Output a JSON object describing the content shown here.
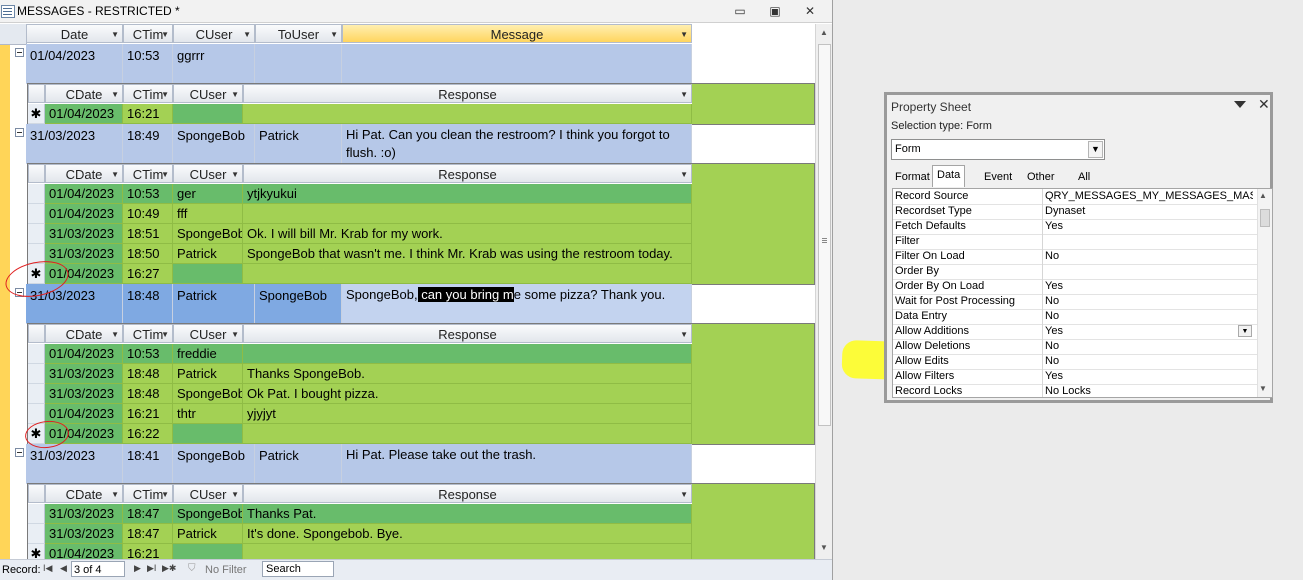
{
  "window": {
    "title": "MESSAGES - RESTRICTED *",
    "min_glyph": "▭",
    "max_glyph": "▣",
    "close_glyph": "✕"
  },
  "master_headers": [
    "Date",
    "CTim",
    "CUser",
    "ToUser",
    "Message"
  ],
  "sub_headers": [
    "CDate",
    "CTim",
    "CUser",
    "Response"
  ],
  "records": [
    {
      "date": "01/04/2023",
      "time": "10:53",
      "cuser": "ggrrr",
      "touser": "",
      "message": "",
      "responses": [
        {
          "date": "01/04/2023",
          "time": "16:21",
          "user": "",
          "text": "",
          "new": true
        }
      ]
    },
    {
      "date": "31/03/2023",
      "time": "18:49",
      "cuser": "SpongeBob",
      "touser": "Patrick",
      "message": "Hi Pat. Can you clean the restroom? I think you forgot to flush. :o)",
      "responses": [
        {
          "date": "01/04/2023",
          "time": "10:53",
          "user": "ger",
          "text": "ytjkyukui"
        },
        {
          "date": "01/04/2023",
          "time": "10:49",
          "user": "fff",
          "text": ""
        },
        {
          "date": "31/03/2023",
          "time": "18:51",
          "user": "SpongeBob",
          "text": "Ok. I will bill Mr. Krab for my work."
        },
        {
          "date": "31/03/2023",
          "time": "18:50",
          "user": "Patrick",
          "text": "SpongeBob that wasn't me. I think Mr. Krab was using the restroom today."
        },
        {
          "date": "01/04/2023",
          "time": "16:27",
          "user": "",
          "text": "",
          "new": true
        }
      ]
    },
    {
      "date": "31/03/2023",
      "time": "18:48",
      "cuser": "Patrick",
      "touser": "SpongeBob",
      "message_pre": "SpongeBob,",
      "message_sel": " can you bring m",
      "message_post": "e some pizza? Thank you.",
      "current": true,
      "responses": [
        {
          "date": "01/04/2023",
          "time": "10:53",
          "user": "freddie",
          "text": ""
        },
        {
          "date": "31/03/2023",
          "time": "18:48",
          "user": "Patrick",
          "text": "Thanks SpongeBob."
        },
        {
          "date": "31/03/2023",
          "time": "18:48",
          "user": "SpongeBob",
          "text": "Ok Pat. I bought pizza."
        },
        {
          "date": "01/04/2023",
          "time": "16:21",
          "user": "thtr",
          "text": "yjyjyt"
        },
        {
          "date": "01/04/2023",
          "time": "16:22",
          "user": "",
          "text": "",
          "new": true
        }
      ]
    },
    {
      "date": "31/03/2023",
      "time": "18:41",
      "cuser": "SpongeBob",
      "touser": "Patrick",
      "message": "Hi Pat. Please take out the trash.",
      "responses": [
        {
          "date": "31/03/2023",
          "time": "18:47",
          "user": "SpongeBob",
          "text": "Thanks Pat."
        },
        {
          "date": "31/03/2023",
          "time": "18:47",
          "user": "Patrick",
          "text": "It's done. Spongebob. Bye."
        },
        {
          "date": "01/04/2023",
          "time": "16:21",
          "user": "",
          "text": "",
          "new": true
        }
      ]
    }
  ],
  "navigation": {
    "label": "Record:",
    "current": "3 of 4",
    "filter": "No Filter",
    "search": "Search"
  },
  "property_sheet": {
    "title": "Property Sheet",
    "selection_type_label": "Selection type:  Form",
    "selected_object": "Form",
    "tabs": [
      "Format",
      "Data",
      "Event",
      "Other",
      "All"
    ],
    "active_tab": "Data",
    "properties": [
      {
        "name": "Record Source",
        "value": "QRY_MESSAGES_MY_MESSAGES_MASTER"
      },
      {
        "name": "Recordset Type",
        "value": "Dynaset"
      },
      {
        "name": "Fetch Defaults",
        "value": "Yes"
      },
      {
        "name": "Filter",
        "value": ""
      },
      {
        "name": "Filter On Load",
        "value": "No"
      },
      {
        "name": "Order By",
        "value": ""
      },
      {
        "name": "Order By On Load",
        "value": "Yes"
      },
      {
        "name": "Wait for Post Processing",
        "value": "No"
      },
      {
        "name": "Data Entry",
        "value": "No"
      },
      {
        "name": "Allow Additions",
        "value": "Yes",
        "combo": true
      },
      {
        "name": "Allow Deletions",
        "value": "No"
      },
      {
        "name": "Allow Edits",
        "value": "No"
      },
      {
        "name": "Allow Filters",
        "value": "Yes"
      },
      {
        "name": "Record Locks",
        "value": "No Locks"
      }
    ]
  },
  "colors": {
    "master_row": "#b6c8e8",
    "subform_row": "#a3d154",
    "subform_current": "#68bc6b",
    "annotation_red": "#e02020",
    "highlight_yellow": "#ffff1a"
  }
}
